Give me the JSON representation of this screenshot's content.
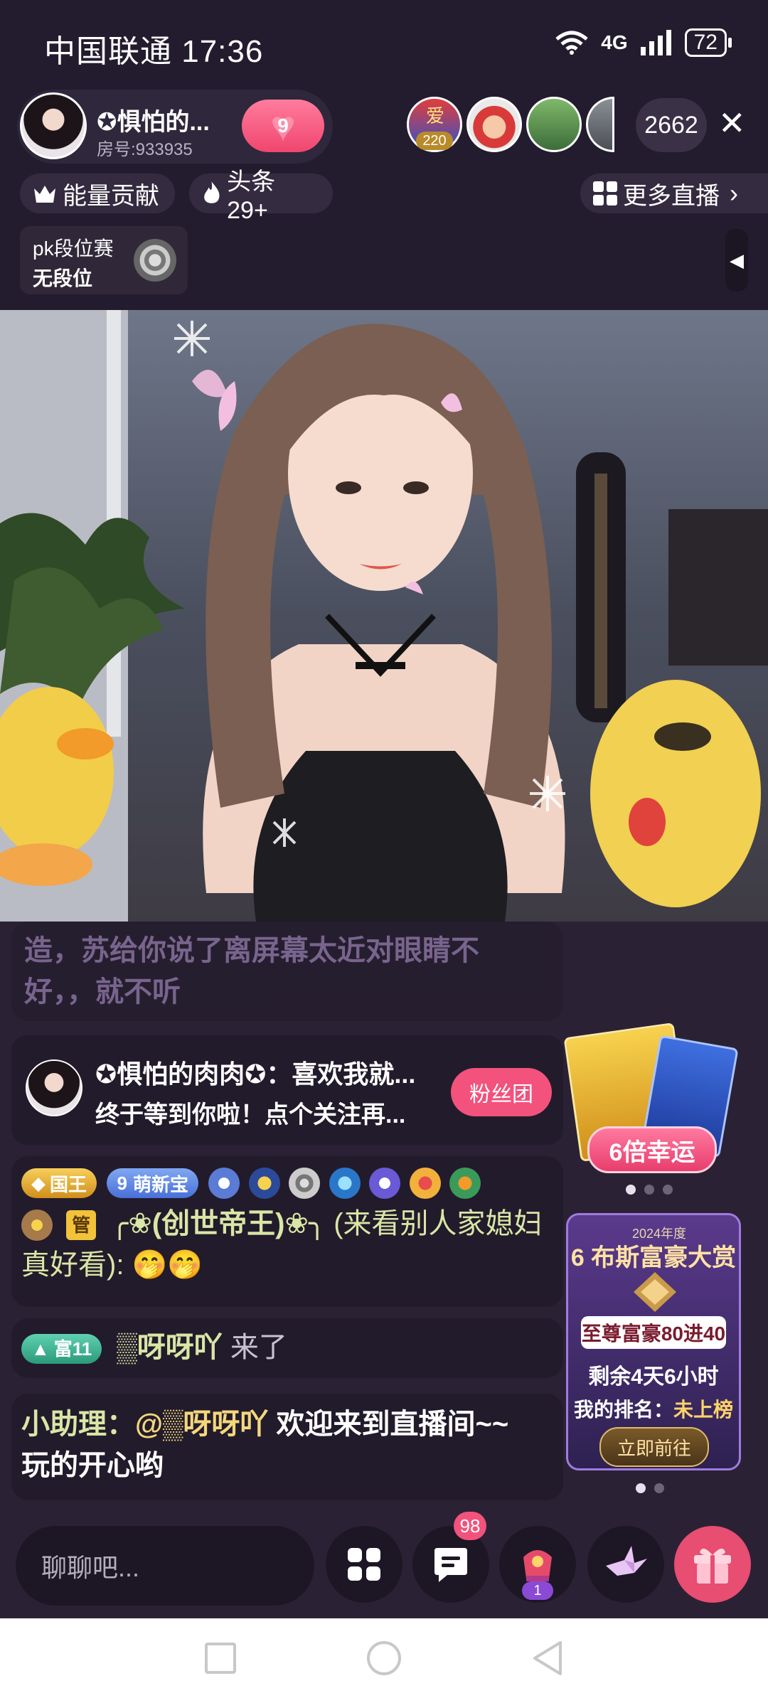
{
  "status_bar": {
    "carrier": "中国联通",
    "time": "17:36",
    "network": "4G",
    "battery": "72"
  },
  "host": {
    "name": "✪惧怕的...",
    "room": "房号:933935",
    "heart_level": "9"
  },
  "viewers": {
    "badge_top": "爱",
    "badge_value": "220",
    "count": "2662"
  },
  "chips": {
    "energy": "能量贡献",
    "headline": "头条 29+",
    "more_live": "更多直播"
  },
  "pk": {
    "title": "pk段位赛",
    "rank": "无段位"
  },
  "chat": {
    "faded_line1": "造，苏给你说了离屏幕太近对眼睛不",
    "faded_line2": "好，，就不听",
    "follow_card": {
      "line1": "✪惧怕的肉肉✪：喜欢我就...",
      "line2": "终于等到你啦！点个关注再...",
      "button": "粉丝团"
    },
    "msg1": {
      "badge_king": "国王",
      "badge_level": "9",
      "badge_new": "萌新宝",
      "badge_admin": "管",
      "user": "╭❀(创世帝王)❀╮",
      "text": "(来看别人家媳妇真好看):",
      "emoji": "🤭🤭"
    },
    "msg2": {
      "badge_rich": "富11",
      "user": "▒呀呀吖",
      "text": "来了"
    },
    "msg3": {
      "prefix": "小助理：",
      "mention": "@▒呀呀吖",
      "text": "欢迎来到直播间~~",
      "text2": "玩的开心哟"
    }
  },
  "promo_lucky": {
    "label": "6倍幸运"
  },
  "promo_rich": {
    "title": "6 布斯富豪大赏",
    "year": "2024年度",
    "subtitle": "至尊富豪80进40",
    "remaining": "剩余4天6小时",
    "rank_label": "我的排名：",
    "rank_value": "未上榜",
    "button": "立即前往"
  },
  "bottom": {
    "placeholder": "聊聊吧...",
    "msg_badge": "98",
    "level_badge": "1"
  },
  "colors": {
    "accent_pink": "#f2527c",
    "chat_name": "#d9e6a6",
    "mention": "#f4d77d",
    "rank_gold": "#ffd36b"
  }
}
